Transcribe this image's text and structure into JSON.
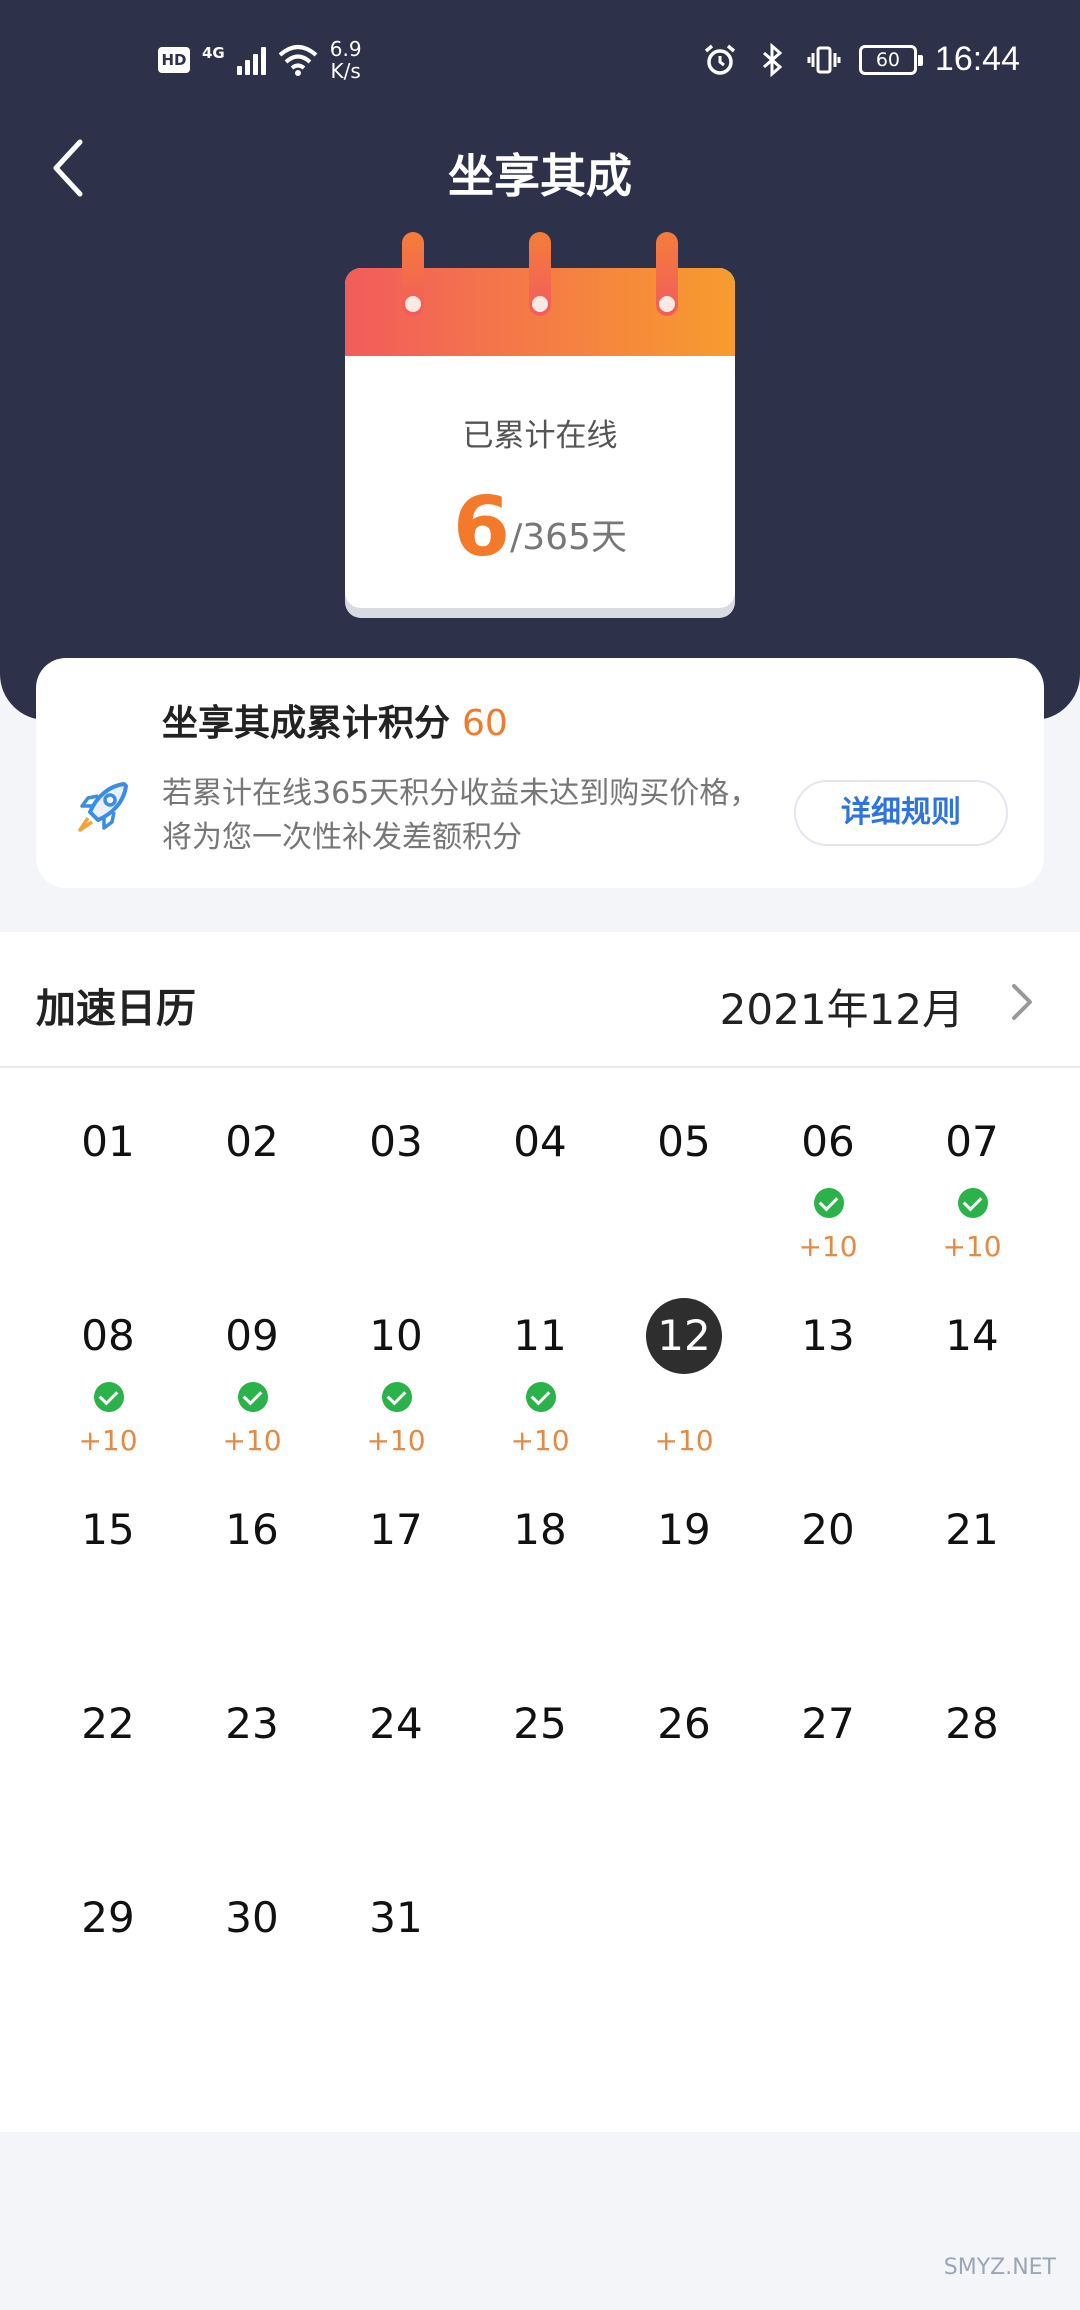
{
  "status_bar": {
    "hd": "HD",
    "network": "4G",
    "speed_value": "6.9",
    "speed_unit": "K/s",
    "battery": "60",
    "time": "16:44"
  },
  "header": {
    "title": "坐享其成"
  },
  "online_calendar": {
    "label": "已累计在线",
    "days_online": "6",
    "days_total": "/365天"
  },
  "points_card": {
    "title": "坐享其成累计积分",
    "points": "60",
    "description": "若累计在线365天积分收益未达到购买价格，将为您一次性补发差额积分",
    "rules_button": "详细规则"
  },
  "calendar": {
    "title": "加速日历",
    "month": "2021年12月",
    "days": [
      {
        "day": "01",
        "checked": false,
        "points": ""
      },
      {
        "day": "02",
        "checked": false,
        "points": ""
      },
      {
        "day": "03",
        "checked": false,
        "points": ""
      },
      {
        "day": "04",
        "checked": false,
        "points": ""
      },
      {
        "day": "05",
        "checked": false,
        "points": ""
      },
      {
        "day": "06",
        "checked": true,
        "points": "+10"
      },
      {
        "day": "07",
        "checked": true,
        "points": "+10"
      },
      {
        "day": "08",
        "checked": true,
        "points": "+10"
      },
      {
        "day": "09",
        "checked": true,
        "points": "+10"
      },
      {
        "day": "10",
        "checked": true,
        "points": "+10"
      },
      {
        "day": "11",
        "checked": true,
        "points": "+10"
      },
      {
        "day": "12",
        "checked": false,
        "points": "+10",
        "today": true
      },
      {
        "day": "13",
        "checked": false,
        "points": ""
      },
      {
        "day": "14",
        "checked": false,
        "points": ""
      },
      {
        "day": "15",
        "checked": false,
        "points": ""
      },
      {
        "day": "16",
        "checked": false,
        "points": ""
      },
      {
        "day": "17",
        "checked": false,
        "points": ""
      },
      {
        "day": "18",
        "checked": false,
        "points": ""
      },
      {
        "day": "19",
        "checked": false,
        "points": ""
      },
      {
        "day": "20",
        "checked": false,
        "points": ""
      },
      {
        "day": "21",
        "checked": false,
        "points": ""
      },
      {
        "day": "22",
        "checked": false,
        "points": ""
      },
      {
        "day": "23",
        "checked": false,
        "points": ""
      },
      {
        "day": "24",
        "checked": false,
        "points": ""
      },
      {
        "day": "25",
        "checked": false,
        "points": ""
      },
      {
        "day": "26",
        "checked": false,
        "points": ""
      },
      {
        "day": "27",
        "checked": false,
        "points": ""
      },
      {
        "day": "28",
        "checked": false,
        "points": ""
      },
      {
        "day": "29",
        "checked": false,
        "points": ""
      },
      {
        "day": "30",
        "checked": false,
        "points": ""
      },
      {
        "day": "31",
        "checked": false,
        "points": ""
      }
    ]
  },
  "watermark": "SMYZ.NET"
}
